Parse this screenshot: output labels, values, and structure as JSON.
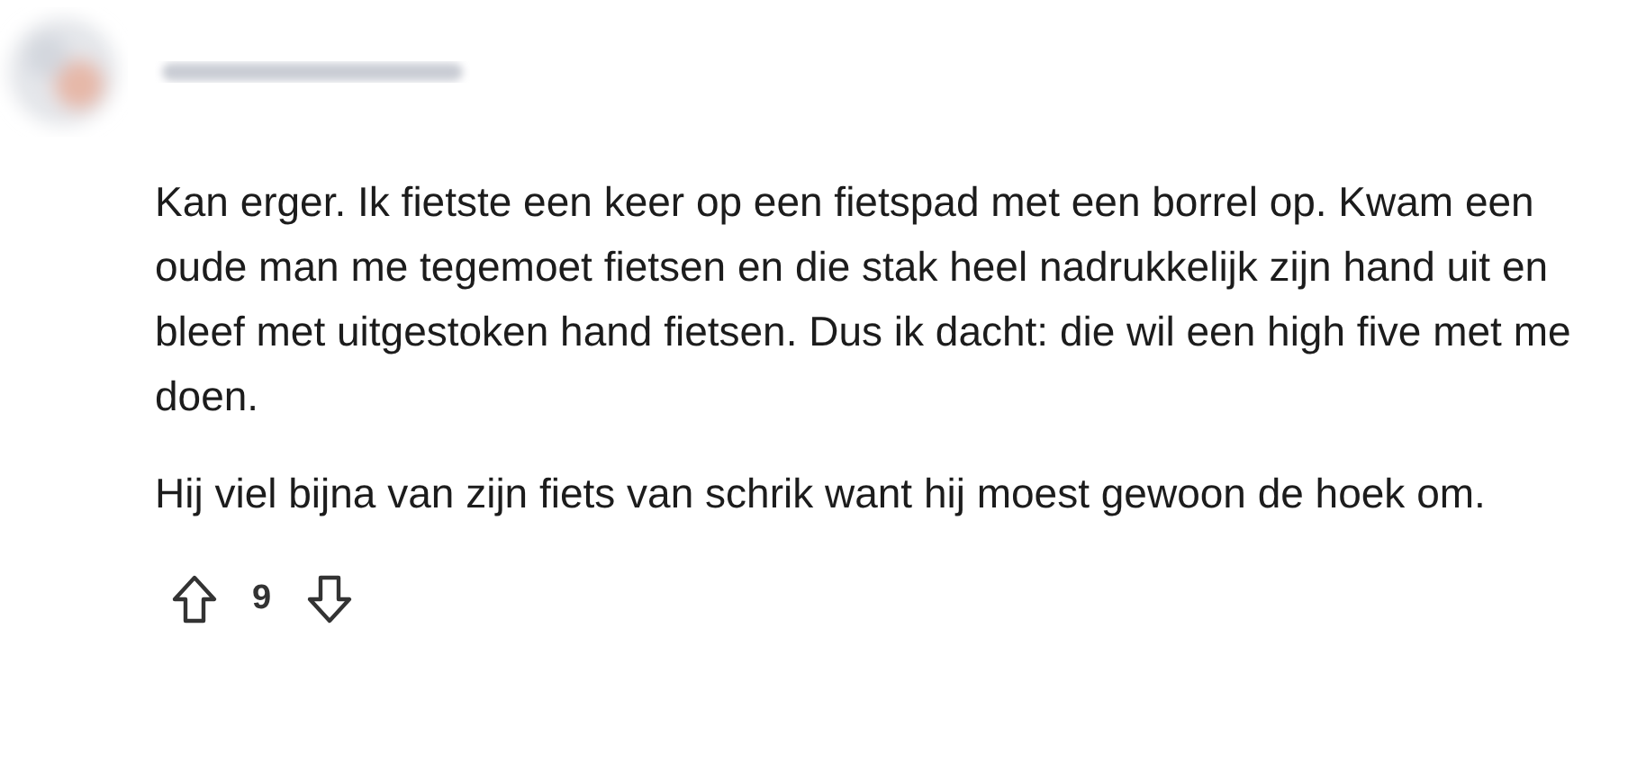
{
  "comment": {
    "paragraphs": [
      "Kan erger. Ik fietste een keer op een fietspad met een borrel op. Kwam een oude man me tegemoet fietsen en die stak heel nadrukkelijk zijn hand uit en bleef met uitgestoken hand fietsen. Dus ik dacht: die wil een high five met me doen.",
      "Hij viel bijna van zijn fiets van schrik want hij moest gewoon de hoek om."
    ],
    "score": "9"
  }
}
